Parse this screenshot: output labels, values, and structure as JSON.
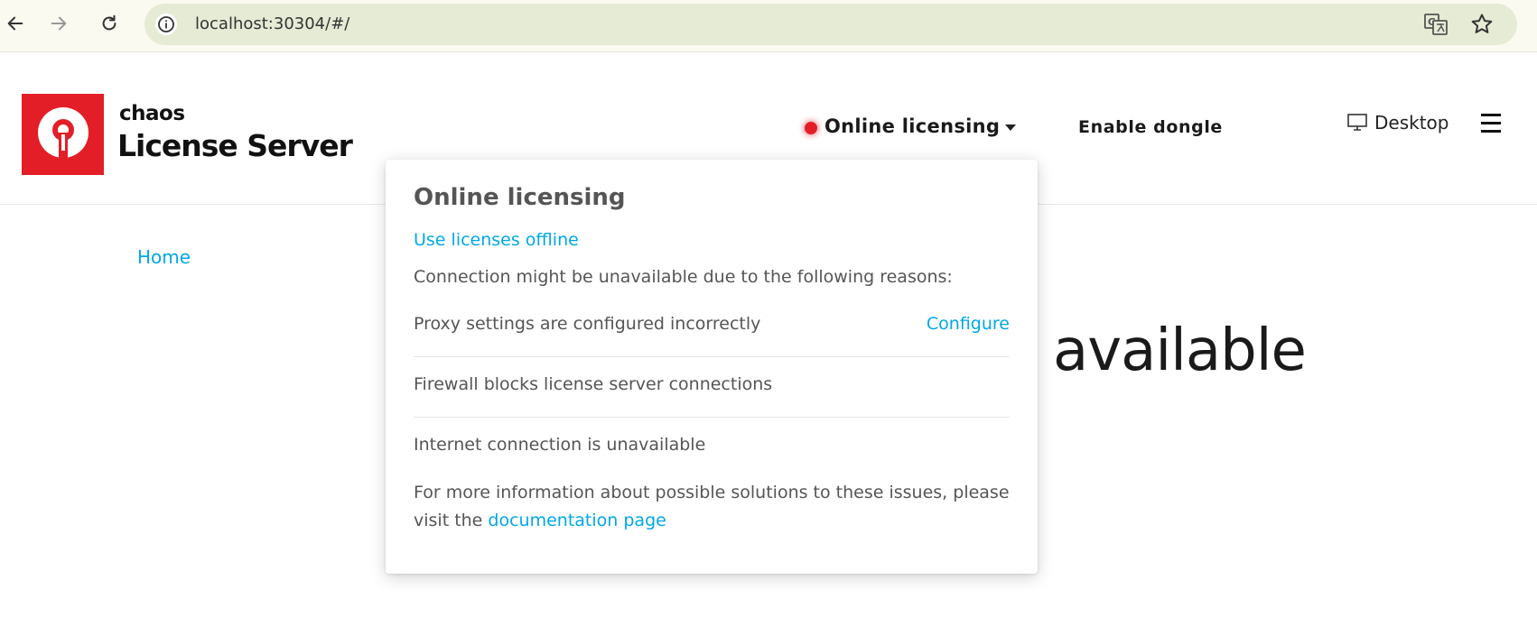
{
  "browser": {
    "url": "localhost:30304/#/"
  },
  "header": {
    "brand_small": "chaos",
    "brand_big": "License Server",
    "licensing_label": "Online licensing",
    "dongle_label": "Enable dongle",
    "desktop_label": "Desktop",
    "status_color": "#e41e26",
    "accent_color": "#00a8e8",
    "logo_color": "#e41e26"
  },
  "page": {
    "home_link": "Home",
    "title_fragment": "available"
  },
  "dropdown": {
    "title": "Online licensing",
    "offline_link": "Use licenses offline",
    "intro": "Connection might be unavailable due to the following reasons:",
    "reasons": [
      {
        "text": "Proxy settings are configured incorrectly",
        "action": "Configure"
      },
      {
        "text": "Firewall blocks license server connections"
      },
      {
        "text": "Internet connection is unavailable"
      }
    ],
    "more_info_prefix": "For more information about possible solutions to these issues, please visit the ",
    "doc_link": "documentation page"
  }
}
